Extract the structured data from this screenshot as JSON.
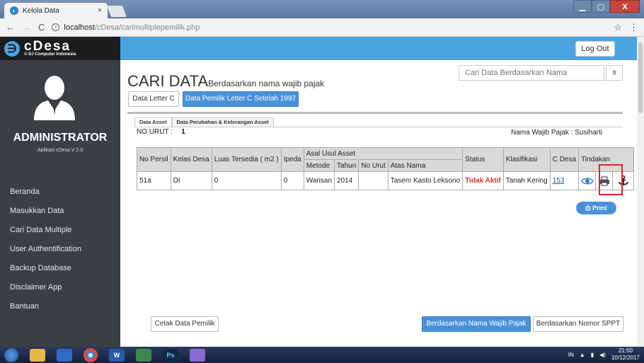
{
  "browser": {
    "tab_title": "Kelola Data",
    "tab_close": "×",
    "url_host": "localhost",
    "url_path": "/cDesa/carimultiplepemilik.php",
    "back": "←",
    "forward": "→",
    "reload": "C",
    "star": "☆",
    "menu": "⋮",
    "window_min": "▁",
    "window_max": "▢",
    "window_close": "X"
  },
  "app": {
    "logo_name": "cDesa",
    "logo_sub": "© DJ Computer Indonesia",
    "logout": "Log Out"
  },
  "sidebar": {
    "role": "ADMINISTRATOR",
    "version": "Aplikasi cDesa V 2.0",
    "items": [
      {
        "label": "Beranda"
      },
      {
        "label": "Masukkan Data"
      },
      {
        "label": "Cari Data Multiple"
      },
      {
        "label": "User Authentification"
      },
      {
        "label": "Backup Database"
      },
      {
        "label": "Disclaimer App"
      },
      {
        "label": "Bantuan"
      }
    ]
  },
  "main": {
    "title": "CARI DATA",
    "subtitle": "Berdasarkan nama wajib pajak",
    "search_placeholder": "Cari Data Berdasarkan Nama",
    "search_button": "fl",
    "btn_letter_c": "Data Letter C",
    "btn_pemilik": "Data Pemilik Letter C Setelah 1997",
    "tabs": [
      {
        "label": "Data Asset"
      },
      {
        "label": "Data Perubahan & Keterangan Asset"
      }
    ],
    "no_urut_label": "NO URUT :",
    "no_urut_value": "1",
    "nama_wajib_pajak": "Nama Wajib Pajak : Susiharti",
    "print": "Print",
    "btn_cetak": "Cetak Data Pemilik",
    "btn_nama": "Berdasarkan Nama Wajib Pajak",
    "btn_sppt": "Berdasarkan Nomor SPPT"
  },
  "table": {
    "headers": {
      "no_persil": "No Persil",
      "kelas_desa": "Kelas Desa",
      "luas": "Luas Tersedia ( m2 )",
      "ipeda": "Ipeda",
      "asal_usul": "Asal Usul Asset",
      "metode": "Metode",
      "tahun": "Tahun",
      "no_urut": "No Urut",
      "atas_nama": "Atas Nama",
      "status": "Status",
      "klasifikasi": "Klasifikasi",
      "c_desa": "C Desa",
      "tindakan": "Tindakan"
    },
    "row": {
      "no_persil": "51a",
      "kelas_desa": "DI",
      "luas": "0",
      "ipeda": "0",
      "metode": "Warisan",
      "tahun": "2014",
      "no_urut": "",
      "atas_nama": "Tasem Kasto Leksono",
      "status": "Tidak Aktif",
      "klasifikasi": "Tanah Kering",
      "c_desa": "153"
    }
  },
  "taskbar": {
    "lang": "IN",
    "time": "21:50",
    "date": "10/12/2017"
  }
}
